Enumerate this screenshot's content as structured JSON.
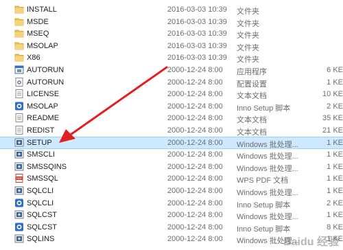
{
  "files": [
    {
      "name": "INSTALL",
      "date": "2016-03-03 10:39",
      "type": "文件夹",
      "size": "",
      "icon": "folder-icon"
    },
    {
      "name": "MSDE",
      "date": "2016-03-03 10:39",
      "type": "文件夹",
      "size": "",
      "icon": "folder-icon"
    },
    {
      "name": "MSEQ",
      "date": "2016-03-03 10:39",
      "type": "文件夹",
      "size": "",
      "icon": "folder-icon"
    },
    {
      "name": "MSOLAP",
      "date": "2016-03-03 10:39",
      "type": "文件夹",
      "size": "",
      "icon": "folder-icon"
    },
    {
      "name": "X86",
      "date": "2016-03-03 10:39",
      "type": "文件夹",
      "size": "",
      "icon": "folder-icon"
    },
    {
      "name": "AUTORUN",
      "date": "2000-12-24 8:00",
      "type": "应用程序",
      "size": "6 KE",
      "icon": "application-icon"
    },
    {
      "name": "AUTORUN",
      "date": "2000-12-24 8:00",
      "type": "配置设置",
      "size": "1 KE",
      "icon": "config-icon"
    },
    {
      "name": "LICENSE",
      "date": "2000-12-24 8:00",
      "type": "文本文档",
      "size": "10 KE",
      "icon": "text-file-icon"
    },
    {
      "name": "MSOLAP",
      "date": "2000-12-24 8:00",
      "type": "Inno Setup 脚本",
      "size": "2 KE",
      "icon": "inno-setup-icon"
    },
    {
      "name": "README",
      "date": "2000-12-24 8:00",
      "type": "文本文档",
      "size": "35 KE",
      "icon": "text-file-icon"
    },
    {
      "name": "REDIST",
      "date": "2000-12-24 8:00",
      "type": "文本文档",
      "size": "21 KE",
      "icon": "text-file-icon"
    },
    {
      "name": "SETUP",
      "date": "2000-12-24 8:00",
      "type": "Windows 批处理...",
      "size": "1 KE",
      "icon": "batch-file-icon"
    },
    {
      "name": "SMSCLI",
      "date": "2000-12-24 8:00",
      "type": "Windows 批处理...",
      "size": "1 KE",
      "icon": "batch-file-icon"
    },
    {
      "name": "SMSSQINS",
      "date": "2000-12-24 8:00",
      "type": "Windows 批处理...",
      "size": "1 KE",
      "icon": "batch-file-icon"
    },
    {
      "name": "SMSSQL",
      "date": "2000-12-24 8:00",
      "type": "WPS PDF 文档",
      "size": "1 KE",
      "icon": "pdf-icon"
    },
    {
      "name": "SQLCLI",
      "date": "2000-12-24 8:00",
      "type": "Windows 批处理...",
      "size": "1 KE",
      "icon": "batch-file-icon"
    },
    {
      "name": "SQLCLI",
      "date": "2000-12-24 8:00",
      "type": "Inno Setup 脚本",
      "size": "2 KE",
      "icon": "inno-setup-icon"
    },
    {
      "name": "SQLCST",
      "date": "2000-12-24 8:00",
      "type": "Windows 批处理...",
      "size": "1 KE",
      "icon": "batch-file-icon"
    },
    {
      "name": "SQLCST",
      "date": "2000-12-24 8:00",
      "type": "Inno Setup 脚本",
      "size": "8 KE",
      "icon": "inno-setup-icon"
    },
    {
      "name": "SQLINS",
      "date": "2000-12-24 8:00",
      "type": "Windows 批处理...",
      "size": "1 KE",
      "icon": "batch-file-icon"
    }
  ],
  "selected_file": "SETUP",
  "watermark": "Baidu 经验",
  "colors": {
    "selection": "#cde8ff",
    "arrow": "#e02020",
    "folder": "#f0c55a"
  }
}
